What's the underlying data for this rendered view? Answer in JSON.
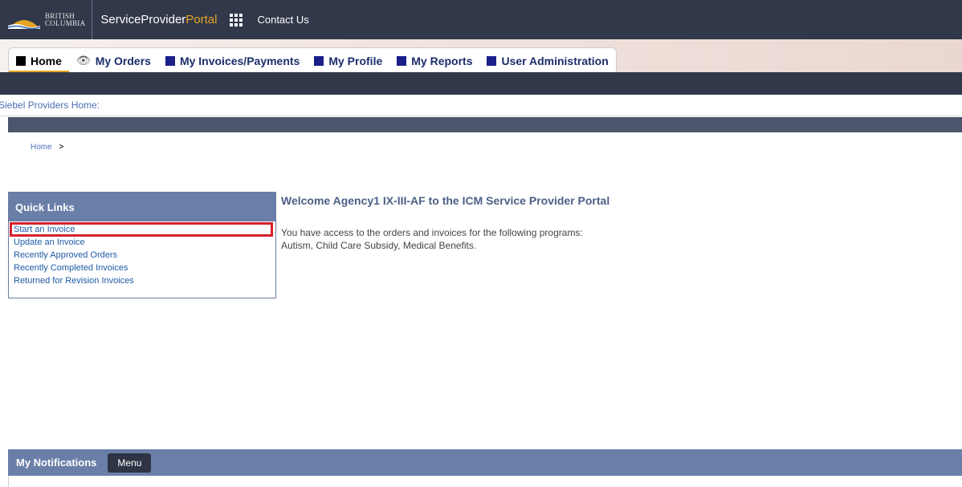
{
  "header": {
    "logo_line1": "BRITISH",
    "logo_line2": "COLUMBIA",
    "portal_name_main": "ServiceProvider",
    "portal_name_accent": "Portal",
    "contact_link": "Contact Us"
  },
  "tabs": [
    {
      "label": "Home",
      "icon": "square-icon",
      "active": true
    },
    {
      "label": "My Orders",
      "icon": "eye-icon",
      "active": false
    },
    {
      "label": "My Invoices/Payments",
      "icon": "square-icon",
      "active": false
    },
    {
      "label": "My Profile",
      "icon": "square-icon",
      "active": false
    },
    {
      "label": "My Reports",
      "icon": "square-icon",
      "active": false
    },
    {
      "label": "User Administration",
      "icon": "square-icon",
      "active": false
    }
  ],
  "providers_home": "Siebel Providers Home:",
  "breadcrumb": {
    "home": "Home",
    "separator": ">"
  },
  "quick_links": {
    "title": "Quick Links",
    "items": [
      "Start an Invoice",
      "Update an Invoice",
      "Recently Approved Orders",
      "Recently Completed Invoices",
      "Returned for Revision Invoices"
    ]
  },
  "welcome": {
    "title": "Welcome Agency1 IX-III-AF to the ICM Service Provider Portal",
    "line1": "You have access to the orders and invoices for the following programs:",
    "line2": "Autism, Child Care Subsidy, Medical Benefits."
  },
  "notifications": {
    "title": "My Notifications",
    "menu_label": "Menu"
  },
  "colors": {
    "header_bg": "#313849",
    "accent": "#e6a426",
    "panel_header": "#6a7fa8",
    "link": "#1f5aa6",
    "highlight": "#d6212c"
  }
}
